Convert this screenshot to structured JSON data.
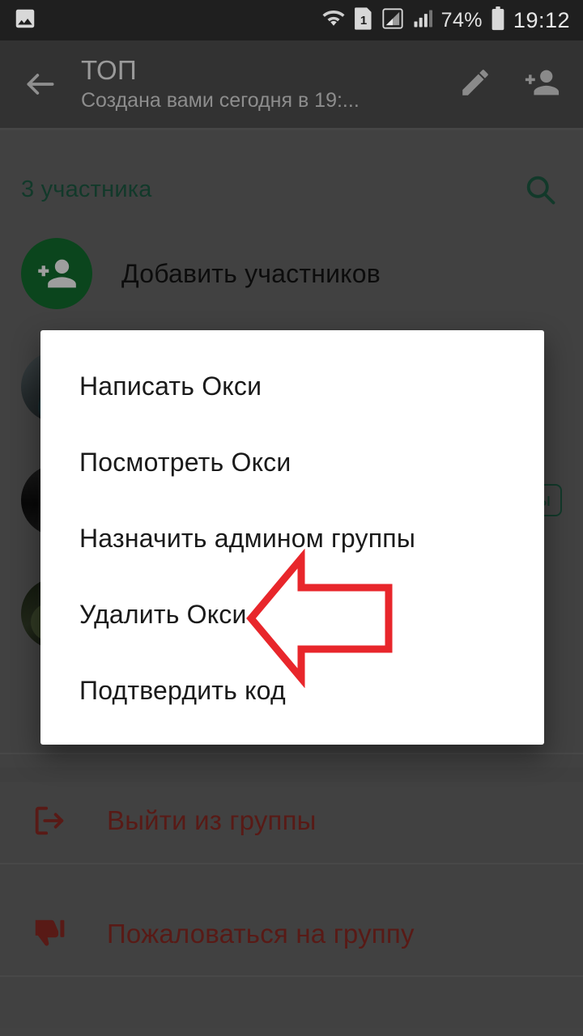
{
  "status_bar": {
    "left_icons": [
      "image-icon"
    ],
    "right_icons": [
      "wifi-icon",
      "sim1-icon",
      "signal-secondary-icon",
      "signal-icon",
      "battery-icon"
    ],
    "battery_percent": "74%",
    "time": "19:12"
  },
  "app_bar": {
    "back_icon": "back-arrow-icon",
    "title": "ТОП",
    "subtitle": "Создана вами сегодня в 19:...",
    "edit_icon": "pencil-icon",
    "add_member_icon": "add-person-icon"
  },
  "members_section": {
    "count_label": "3 участника",
    "search_icon": "search-icon",
    "add_members_label": "Добавить участников",
    "rows": [
      {
        "avatar": "add-person-avatar",
        "label": "Добавить участников",
        "badge": ""
      },
      {
        "avatar": "member-photo-1",
        "label": "",
        "badge": ""
      },
      {
        "avatar": "member-photo-2",
        "label": "",
        "badge": "Админ группы"
      },
      {
        "avatar": "member-photo-3",
        "label": "",
        "badge": ""
      }
    ]
  },
  "dialog": {
    "items": [
      "Написать Окси",
      "Посмотреть Окси",
      "Назначить админом группы",
      "Удалить Окси",
      "Подтвердить код"
    ]
  },
  "bottom_actions": [
    {
      "icon": "exit-icon",
      "label": "Выйти из группы"
    },
    {
      "icon": "thumbs-down-icon",
      "label": "Пожаловаться на группу"
    }
  ],
  "annotation": {
    "shape": "left-arrow",
    "color": "#e8262b",
    "points_to": "Удалить Окси"
  },
  "colors": {
    "accent_green": "#1d5c44",
    "avatar_green": "#12702f",
    "danger_red": "#8e2b24",
    "annotation_red": "#e8262b",
    "status_bar_bg": "#1f1f1f",
    "app_bar_bg": "#323232",
    "page_bg": "#6a6a6a"
  }
}
